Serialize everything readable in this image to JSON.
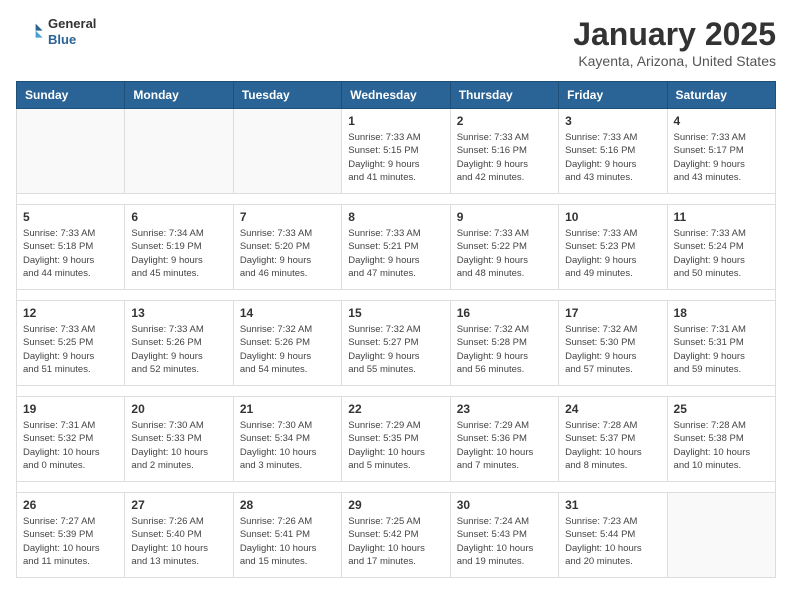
{
  "logo": {
    "general": "General",
    "blue": "Blue"
  },
  "title": "January 2025",
  "subtitle": "Kayenta, Arizona, United States",
  "days_header": [
    "Sunday",
    "Monday",
    "Tuesday",
    "Wednesday",
    "Thursday",
    "Friday",
    "Saturday"
  ],
  "weeks": [
    [
      {
        "day": "",
        "info": ""
      },
      {
        "day": "",
        "info": ""
      },
      {
        "day": "",
        "info": ""
      },
      {
        "day": "1",
        "info": "Sunrise: 7:33 AM\nSunset: 5:15 PM\nDaylight: 9 hours\nand 41 minutes."
      },
      {
        "day": "2",
        "info": "Sunrise: 7:33 AM\nSunset: 5:16 PM\nDaylight: 9 hours\nand 42 minutes."
      },
      {
        "day": "3",
        "info": "Sunrise: 7:33 AM\nSunset: 5:16 PM\nDaylight: 9 hours\nand 43 minutes."
      },
      {
        "day": "4",
        "info": "Sunrise: 7:33 AM\nSunset: 5:17 PM\nDaylight: 9 hours\nand 43 minutes."
      }
    ],
    [
      {
        "day": "5",
        "info": "Sunrise: 7:33 AM\nSunset: 5:18 PM\nDaylight: 9 hours\nand 44 minutes."
      },
      {
        "day": "6",
        "info": "Sunrise: 7:34 AM\nSunset: 5:19 PM\nDaylight: 9 hours\nand 45 minutes."
      },
      {
        "day": "7",
        "info": "Sunrise: 7:33 AM\nSunset: 5:20 PM\nDaylight: 9 hours\nand 46 minutes."
      },
      {
        "day": "8",
        "info": "Sunrise: 7:33 AM\nSunset: 5:21 PM\nDaylight: 9 hours\nand 47 minutes."
      },
      {
        "day": "9",
        "info": "Sunrise: 7:33 AM\nSunset: 5:22 PM\nDaylight: 9 hours\nand 48 minutes."
      },
      {
        "day": "10",
        "info": "Sunrise: 7:33 AM\nSunset: 5:23 PM\nDaylight: 9 hours\nand 49 minutes."
      },
      {
        "day": "11",
        "info": "Sunrise: 7:33 AM\nSunset: 5:24 PM\nDaylight: 9 hours\nand 50 minutes."
      }
    ],
    [
      {
        "day": "12",
        "info": "Sunrise: 7:33 AM\nSunset: 5:25 PM\nDaylight: 9 hours\nand 51 minutes."
      },
      {
        "day": "13",
        "info": "Sunrise: 7:33 AM\nSunset: 5:26 PM\nDaylight: 9 hours\nand 52 minutes."
      },
      {
        "day": "14",
        "info": "Sunrise: 7:32 AM\nSunset: 5:26 PM\nDaylight: 9 hours\nand 54 minutes."
      },
      {
        "day": "15",
        "info": "Sunrise: 7:32 AM\nSunset: 5:27 PM\nDaylight: 9 hours\nand 55 minutes."
      },
      {
        "day": "16",
        "info": "Sunrise: 7:32 AM\nSunset: 5:28 PM\nDaylight: 9 hours\nand 56 minutes."
      },
      {
        "day": "17",
        "info": "Sunrise: 7:32 AM\nSunset: 5:30 PM\nDaylight: 9 hours\nand 57 minutes."
      },
      {
        "day": "18",
        "info": "Sunrise: 7:31 AM\nSunset: 5:31 PM\nDaylight: 9 hours\nand 59 minutes."
      }
    ],
    [
      {
        "day": "19",
        "info": "Sunrise: 7:31 AM\nSunset: 5:32 PM\nDaylight: 10 hours\nand 0 minutes."
      },
      {
        "day": "20",
        "info": "Sunrise: 7:30 AM\nSunset: 5:33 PM\nDaylight: 10 hours\nand 2 minutes."
      },
      {
        "day": "21",
        "info": "Sunrise: 7:30 AM\nSunset: 5:34 PM\nDaylight: 10 hours\nand 3 minutes."
      },
      {
        "day": "22",
        "info": "Sunrise: 7:29 AM\nSunset: 5:35 PM\nDaylight: 10 hours\nand 5 minutes."
      },
      {
        "day": "23",
        "info": "Sunrise: 7:29 AM\nSunset: 5:36 PM\nDaylight: 10 hours\nand 7 minutes."
      },
      {
        "day": "24",
        "info": "Sunrise: 7:28 AM\nSunset: 5:37 PM\nDaylight: 10 hours\nand 8 minutes."
      },
      {
        "day": "25",
        "info": "Sunrise: 7:28 AM\nSunset: 5:38 PM\nDaylight: 10 hours\nand 10 minutes."
      }
    ],
    [
      {
        "day": "26",
        "info": "Sunrise: 7:27 AM\nSunset: 5:39 PM\nDaylight: 10 hours\nand 11 minutes."
      },
      {
        "day": "27",
        "info": "Sunrise: 7:26 AM\nSunset: 5:40 PM\nDaylight: 10 hours\nand 13 minutes."
      },
      {
        "day": "28",
        "info": "Sunrise: 7:26 AM\nSunset: 5:41 PM\nDaylight: 10 hours\nand 15 minutes."
      },
      {
        "day": "29",
        "info": "Sunrise: 7:25 AM\nSunset: 5:42 PM\nDaylight: 10 hours\nand 17 minutes."
      },
      {
        "day": "30",
        "info": "Sunrise: 7:24 AM\nSunset: 5:43 PM\nDaylight: 10 hours\nand 19 minutes."
      },
      {
        "day": "31",
        "info": "Sunrise: 7:23 AM\nSunset: 5:44 PM\nDaylight: 10 hours\nand 20 minutes."
      },
      {
        "day": "",
        "info": ""
      }
    ]
  ]
}
